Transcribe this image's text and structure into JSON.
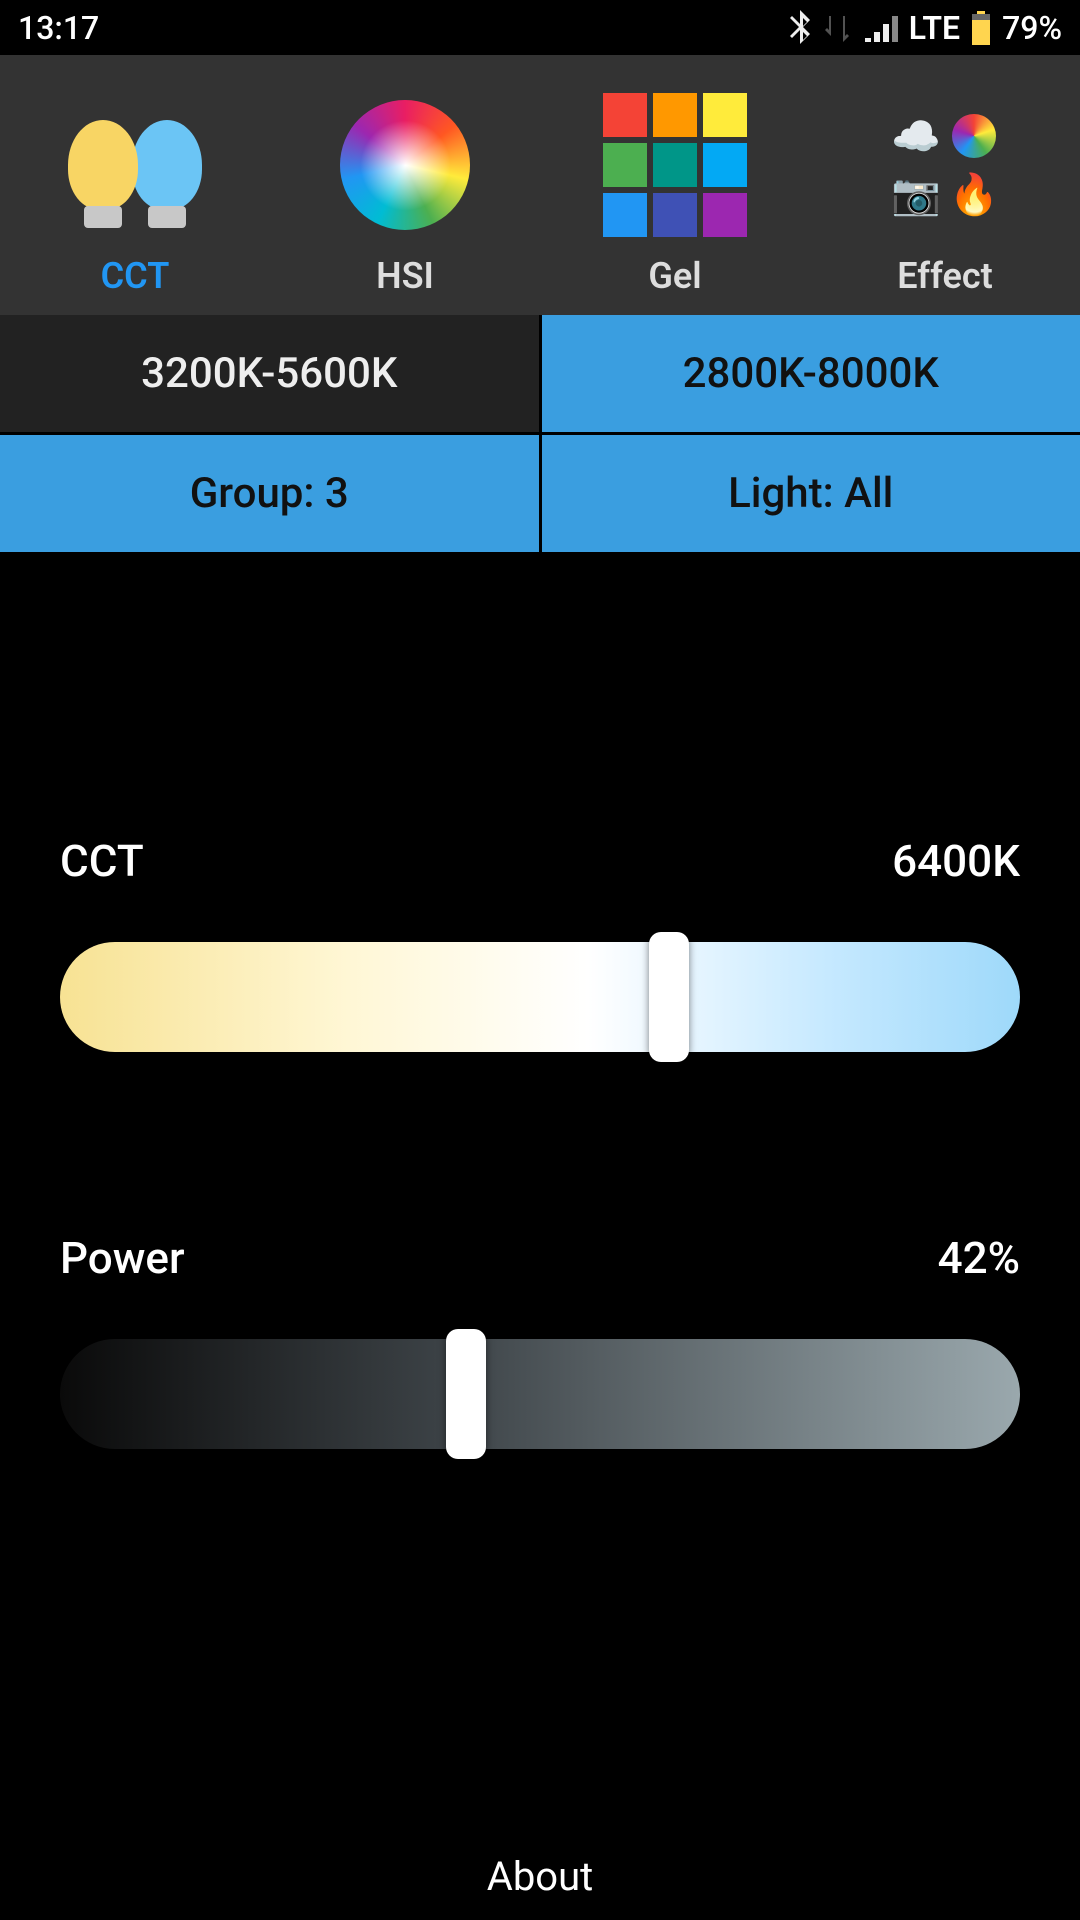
{
  "statusbar": {
    "time": "13:17",
    "network": "LTE",
    "battery": "79%"
  },
  "tabs": {
    "cct": {
      "label": "CCT",
      "active": true
    },
    "hsi": {
      "label": "HSI",
      "active": false
    },
    "gel": {
      "label": "Gel",
      "active": false
    },
    "effect": {
      "label": "Effect",
      "active": false
    }
  },
  "ranges": {
    "narrow": "3200K-5600K",
    "wide": "2800K-8000K",
    "selected": "wide"
  },
  "selectors": {
    "group": "Group: 3",
    "light": "Light: All"
  },
  "sliders": {
    "cct": {
      "label": "CCT",
      "display": "6400K",
      "percent": 64
    },
    "power": {
      "label": "Power",
      "display": "42%",
      "percent": 42
    }
  },
  "footer": {
    "about": "About"
  }
}
